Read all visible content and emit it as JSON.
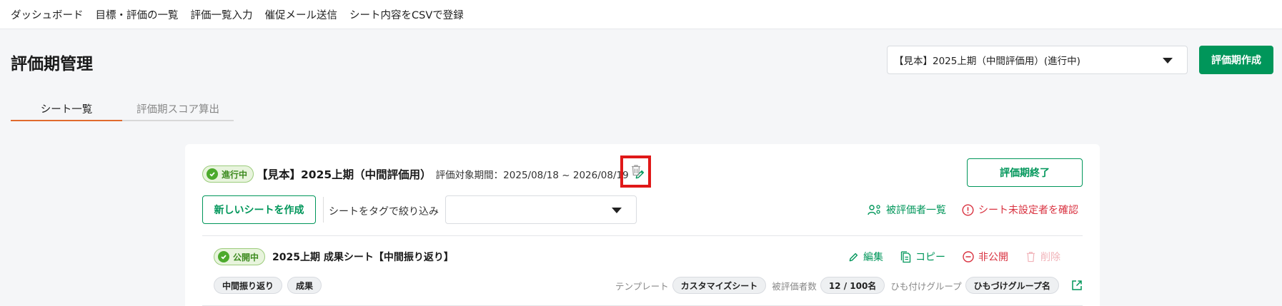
{
  "nav": {
    "items": [
      "ダッシュボード",
      "目標・評価の一覧",
      "評価一覧入力",
      "催促メール送信",
      "シート内容をCSVで登録"
    ]
  },
  "page": {
    "title": "評価期管理",
    "period_select_value": "【見本】2025上期（中間評価用）(進行中)",
    "create_period_label": "評価期作成"
  },
  "tabs": [
    {
      "label": "シート一覧",
      "active": true
    },
    {
      "label": "評価期スコア算出",
      "active": false
    }
  ],
  "period": {
    "status": "進行中",
    "name": "【見本】2025上期（中間評価用）",
    "range": "評価対象期間：2025/08/18 ~ 2026/08/19",
    "end_label": "評価期終了",
    "new_sheet_label": "新しいシートを作成",
    "filter_label": "シートをタグで絞り込み",
    "evaluatees_label": "被評価者一覧",
    "unset_label": "シート未設定者を確認"
  },
  "sheet": {
    "status": "公開中",
    "name": "2025上期 成果シート【中間振り返り】",
    "actions": {
      "edit": "編集",
      "copy": "コピー",
      "unpublish": "非公開",
      "delete": "削除"
    },
    "tags": [
      "中間振り返り",
      "成果"
    ],
    "template_label": "テンプレート",
    "template_value": "カスタマイズシート",
    "evaluatee_count_label": "被評価者数",
    "evaluatee_count_value": "12 / 100名",
    "group_label": "ひも付けグループ",
    "group_value": "ひもづけグループ名"
  },
  "colors": {
    "accent": "#00965a",
    "danger": "#d93240",
    "highlight": "#e01818",
    "tab_underline": "#e06a2e"
  }
}
